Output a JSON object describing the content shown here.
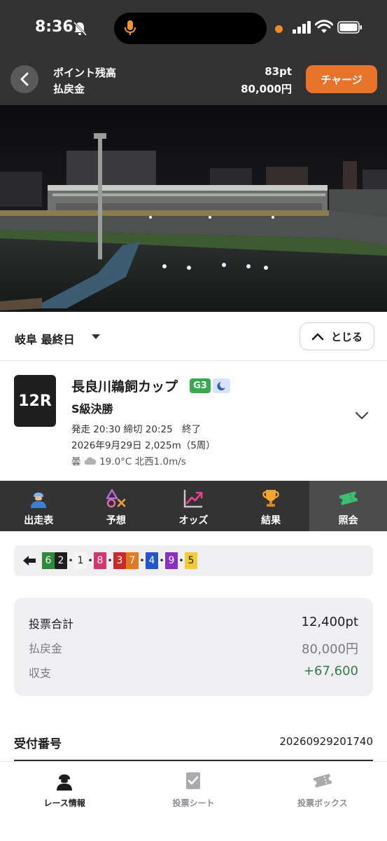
{
  "status_bar": {
    "time": "8:36"
  },
  "header": {
    "points_label": "ポイント残高",
    "payout_label": "払戻金",
    "points_value": "83pt",
    "payout_value": "80,000円",
    "charge_button": "チャージ",
    "accent_color": "#e8732a"
  },
  "venue": {
    "name": "岐阜 最終日",
    "close_button": "とじる"
  },
  "race": {
    "number": "12R",
    "title": "長良川鵜飼カップ",
    "grade": "G3",
    "class": "S級決勝",
    "schedule": "発走 20:30 締切 20:25　終了",
    "date_distance": "2026年9月29日 2,025m（5周）",
    "weather": "曇",
    "weather_icon": "cloud-icon",
    "conditions": "19.0°C 北西1.0m/s"
  },
  "tabs": [
    {
      "label": "出走表",
      "icon": "rider-icon"
    },
    {
      "label": "予想",
      "icon": "prediction-symbols-icon"
    },
    {
      "label": "オッズ",
      "icon": "chart-up-icon"
    },
    {
      "label": "結果",
      "icon": "trophy-icon"
    },
    {
      "label": "照会",
      "icon": "ticket-icon",
      "active": true
    }
  ],
  "result_order": {
    "arrow_icon": "arrow-left-icon",
    "chips": [
      {
        "n": "6",
        "bg": "#2e8b3d",
        "fg": "#ffffff"
      },
      {
        "n": "2",
        "bg": "#1f1f1f",
        "fg": "#ffffff",
        "sep_after": "•"
      },
      {
        "n": "1",
        "bg": "#f4f4f4",
        "fg": "#222222",
        "sep_after": "•"
      },
      {
        "n": "8",
        "bg": "#d1366f",
        "fg": "#ffffff",
        "sep_after": "•"
      },
      {
        "n": "3",
        "bg": "#c62b2b",
        "fg": "#ffffff"
      },
      {
        "n": "7",
        "bg": "#e07a22",
        "fg": "#ffffff",
        "sep_after": "•"
      },
      {
        "n": "4",
        "bg": "#2357c6",
        "fg": "#ffffff",
        "sep_after": "•"
      },
      {
        "n": "9",
        "bg": "#8a2fc4",
        "fg": "#ffffff",
        "sep_after": "•"
      },
      {
        "n": "5",
        "bg": "#f2cc35",
        "fg": "#222222"
      }
    ]
  },
  "summary": {
    "total_label": "投票合計",
    "total_value": "12,400pt",
    "payout_label": "払戻金",
    "payout_value": "80,000円",
    "balance_label": "収支",
    "balance_value": "+67,600",
    "balance_color": "#2f7a55"
  },
  "receipt": {
    "label": "受付番号",
    "number": "20260929201740"
  },
  "bottom_nav": [
    {
      "label": "レース情報",
      "icon": "rider-icon",
      "active": true
    },
    {
      "label": "投票シート",
      "icon": "vote-sheet-icon",
      "active": false
    },
    {
      "label": "投票ボックス",
      "icon": "ticket-box-icon",
      "active": false
    }
  ]
}
